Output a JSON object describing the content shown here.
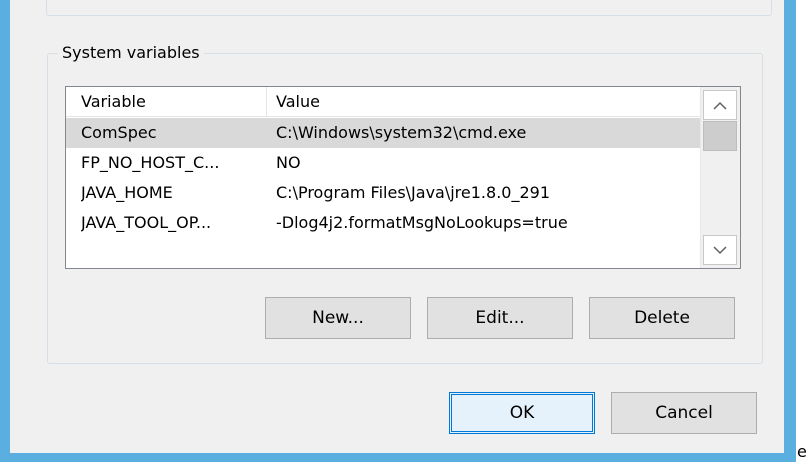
{
  "section": {
    "label": "System variables"
  },
  "table": {
    "columns": [
      "Variable",
      "Value"
    ],
    "rows": [
      {
        "variable": "ComSpec",
        "value": "C:\\Windows\\system32\\cmd.exe",
        "selected": true
      },
      {
        "variable": "FP_NO_HOST_C...",
        "value": "NO",
        "selected": false
      },
      {
        "variable": "JAVA_HOME",
        "value": "C:\\Program Files\\Java\\jre1.8.0_291",
        "selected": false
      },
      {
        "variable": "JAVA_TOOL_OP...",
        "value": "-Dlog4j2.formatMsgNoLookups=true",
        "selected": false
      }
    ]
  },
  "scrollbar": {
    "up_icon": "chevron-up-icon",
    "down_icon": "chevron-down-icon"
  },
  "buttons": {
    "new": "New...",
    "edit": "Edit...",
    "delete": "Delete",
    "ok": "OK",
    "cancel": "Cancel"
  },
  "background_fragment": "e",
  "colors": {
    "window_border": "#5aaee0",
    "dialog_bg": "#f0f0f0",
    "selected_row": "#d9d9d9",
    "default_button_border": "#0078d7"
  }
}
